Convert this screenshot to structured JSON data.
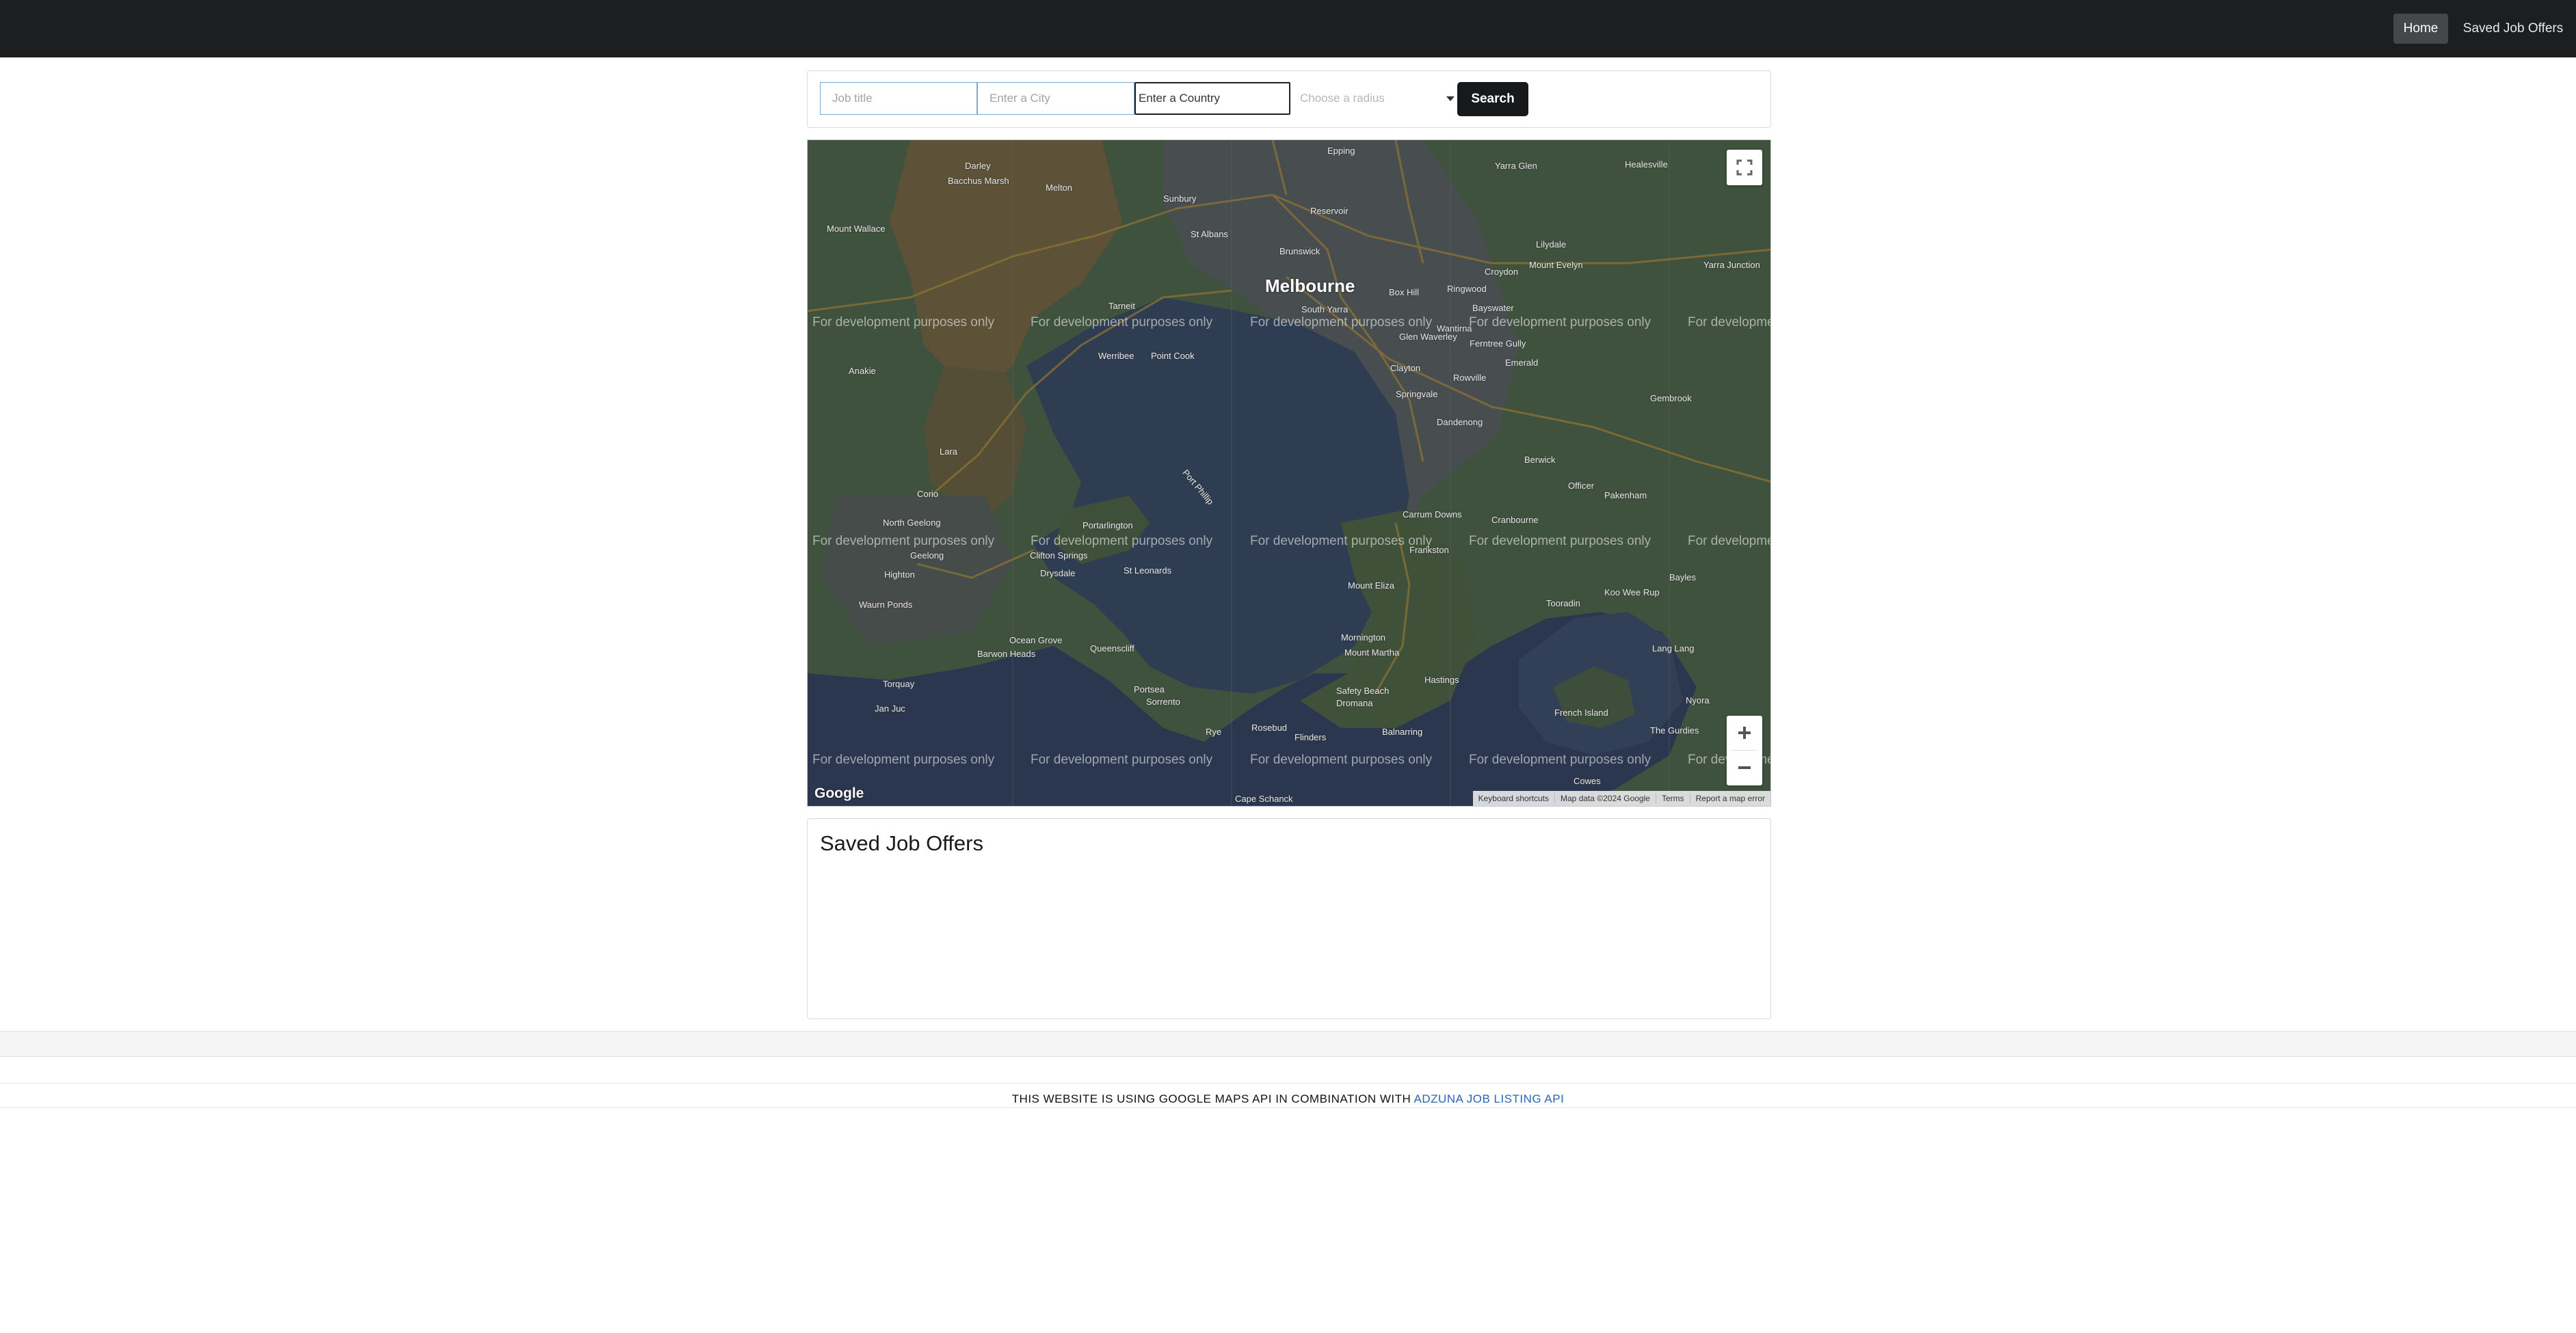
{
  "navbar": {
    "home_label": "Home",
    "saved_label": "Saved Job Offers"
  },
  "search": {
    "job_placeholder": "Job title",
    "city_placeholder": "Enter a City",
    "country_placeholder": "Enter a Country",
    "radius_placeholder": "Choose a radius",
    "button_label": "Search"
  },
  "map": {
    "dev_watermark": "For development purposes only",
    "main_city": "Melbourne",
    "towns": [
      "Darley",
      "Bacchus Marsh",
      "Melton",
      "Mount Wallace",
      "Sunbury",
      "Epping",
      "Yarra Glen",
      "Healesville",
      "Reservoir",
      "St Albans",
      "Brunswick",
      "Croydon",
      "Mount Evelyn",
      "Box Hill",
      "Ringwood",
      "Lilydale",
      "Yarra Junction",
      "South Yarra",
      "Bayswater",
      "Wantirna",
      "Ferntree Gully",
      "Tarneit",
      "Werribee",
      "Point Cook",
      "Glen Waverley",
      "Clayton",
      "Springvale",
      "Rowville",
      "Emerald",
      "Gembrook",
      "Anakie",
      "Dandenong",
      "Lara",
      "Berwick",
      "Officer",
      "Pakenham",
      "Corio",
      "North Geelong",
      "Portarlington",
      "Carrum Downs",
      "Cranbourne",
      "Geelong",
      "Clifton Springs",
      "Drysdale",
      "St Leonards",
      "Frankston",
      "Mount Eliza",
      "Koo Wee Rup",
      "Bayles",
      "Tooradin",
      "Waurn Ponds",
      "Highton",
      "Ocean Grove",
      "Barwon Heads",
      "Queenscliff",
      "Mornington",
      "Mount Martha",
      "Hastings",
      "Torquay",
      "Jan Juc",
      "Portsea",
      "Sorrento",
      "Rye",
      "Rosebud",
      "Dromana",
      "Safety Beach",
      "Balnarring",
      "Flinders",
      "Cape Schanck",
      "French Island",
      "Lang Lang",
      "The Gurdies",
      "Nyora",
      "Cowes",
      "Port Phillip"
    ],
    "google_logo": "Google",
    "attribution": [
      "Keyboard shortcuts",
      "Map data ©2024 Google",
      "Terms",
      "Report a map error"
    ]
  },
  "saved": {
    "title": "Saved Job Offers"
  },
  "footer": {
    "text": "THIS WEBSITE IS USING GOOGLE MAPS API IN COMBINATION WITH",
    "link": "ADZUNA JOB LISTING API"
  }
}
